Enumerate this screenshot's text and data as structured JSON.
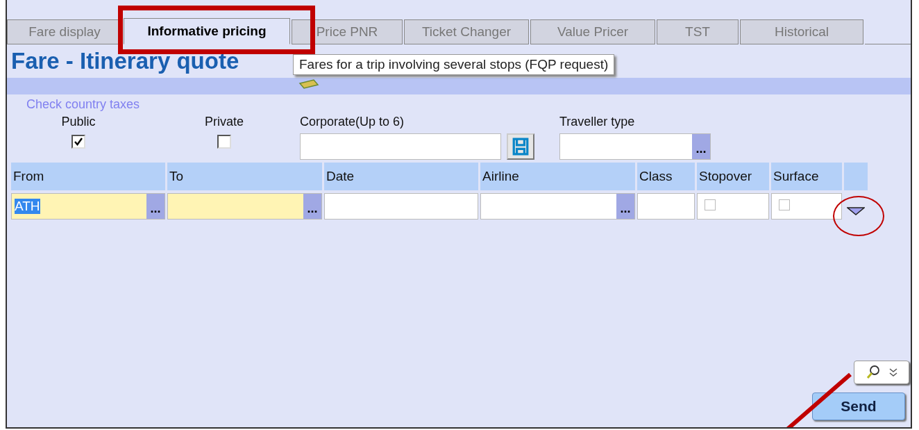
{
  "tabs": [
    {
      "label": "Fare display",
      "selected": false
    },
    {
      "label": "Informative pricing",
      "selected": true
    },
    {
      "label": "Price PNR",
      "selected": false
    },
    {
      "label": "Ticket Changer",
      "selected": false
    },
    {
      "label": "Value Pricer",
      "selected": false
    },
    {
      "label": "TST",
      "selected": false
    },
    {
      "label": "Historical",
      "selected": false
    }
  ],
  "title": "Fare - Itinerary quote",
  "tooltip": "Fares for a trip involving several stops (FQP request)",
  "taxes_link": "Check country taxes",
  "fare_options": [
    {
      "label": "Public",
      "checked": true
    },
    {
      "label": "Private",
      "checked": false
    }
  ],
  "corporate": {
    "label": "Corporate(Up to 6)"
  },
  "traveller_type": {
    "label": "Traveller type",
    "picker": "..."
  },
  "columns": [
    "From",
    "To",
    "Date",
    "Airline",
    "Class",
    "Stopover",
    "Surface"
  ],
  "row": {
    "from": "ATH",
    "from_picker": "...",
    "to_picker": "...",
    "airline_picker": "...",
    "stopover": false,
    "surface": false
  },
  "send_button": "Send"
}
